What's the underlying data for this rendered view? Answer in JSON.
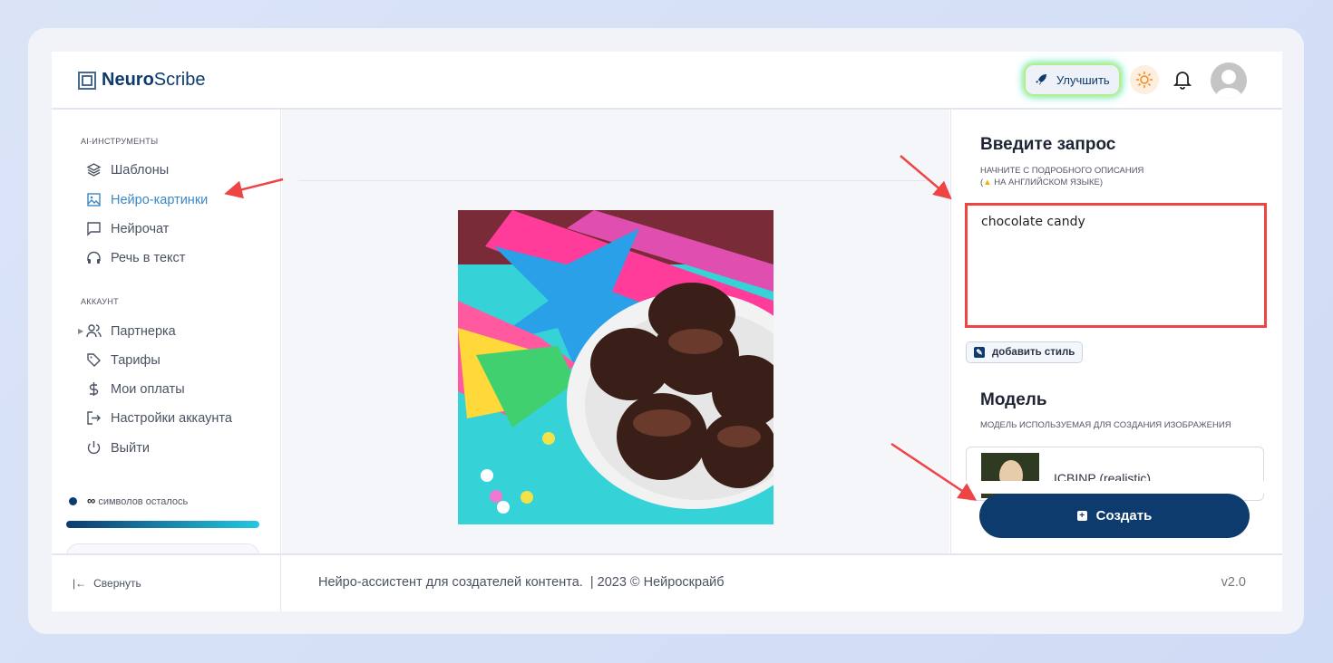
{
  "brand": {
    "bold": "Neuro",
    "light": "Scribe"
  },
  "header": {
    "upgrade_label": "Улучшить",
    "icons": [
      "rocket-icon",
      "sun-icon",
      "bell-icon",
      "avatar"
    ]
  },
  "sidebar": {
    "section_tools": "AI-ИНСТРУМЕНТЫ",
    "tools": [
      {
        "label": "Шаблоны",
        "icon": "layers-icon"
      },
      {
        "label": "Нейро-картинки",
        "icon": "image-icon",
        "active": true
      },
      {
        "label": "Нейрочат",
        "icon": "chat-icon"
      },
      {
        "label": "Речь в текст",
        "icon": "headphones-icon"
      }
    ],
    "section_account": "АККАУНТ",
    "account": [
      {
        "label": "Партнерка",
        "icon": "users-icon"
      },
      {
        "label": "Тарифы",
        "icon": "tag-icon"
      },
      {
        "label": "Мои оплаты",
        "icon": "dollar-icon"
      },
      {
        "label": "Настройки аккаунта",
        "icon": "logout-arrow-icon"
      },
      {
        "label": "Выйти",
        "icon": "power-icon"
      }
    ],
    "symbols_infinity": "∞",
    "symbols_label": "символов осталось",
    "collapse_label": "Свернуть"
  },
  "prompt": {
    "title": "Введите запрос",
    "hint_line1": "НАЧНИТЕ С ПОДРОБНОГО ОПИСАНИЯ",
    "hint_line2": "НА АНГЛИЙСКОМ ЯЗЫКЕ)",
    "hint_open": "(",
    "value": "chocolate candy",
    "add_style": "добавить стиль"
  },
  "model": {
    "title": "Модель",
    "hint": "МОДЕЛЬ ИСПОЛЬЗУЕМАЯ ДЛЯ СОЗДАНИЯ ИЗОБРАЖЕНИЯ",
    "selected": "ICBINP (realistic)"
  },
  "create_label": "Создать",
  "footer": {
    "text": "Нейро-ассистент для создателей контента.  | 2023 © Нейроскрайб",
    "version": "v2.0"
  },
  "colors": {
    "brand": "#0d3b6e",
    "active": "#3b87c4",
    "annotation": "#ef4444"
  }
}
